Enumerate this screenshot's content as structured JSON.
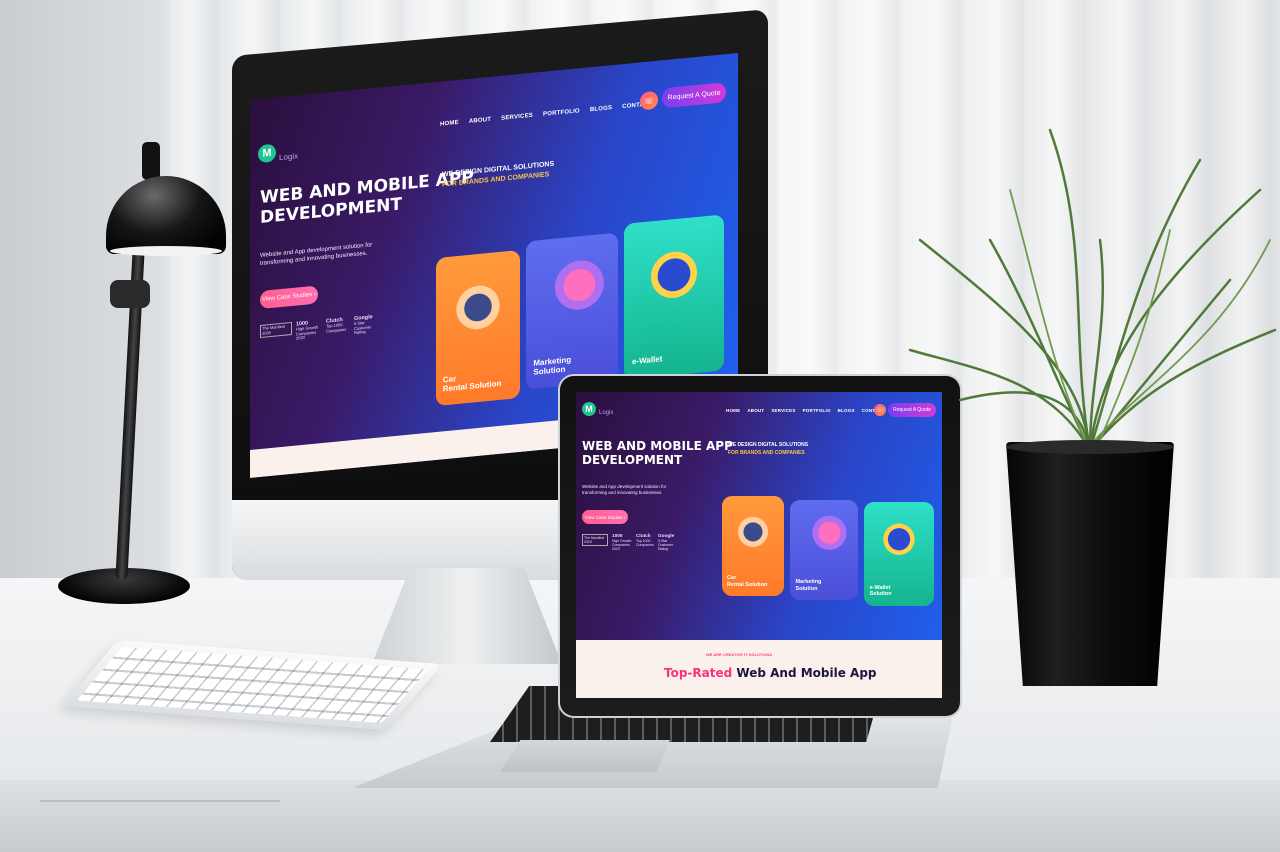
{
  "scene": {
    "description_free": true
  },
  "site": {
    "logo_letter": "M",
    "logo_text": "Logix",
    "nav": [
      "HOME",
      "ABOUT",
      "SERVICES",
      "PORTFOLIO",
      "BLOGS",
      "CONTACT"
    ],
    "quote_label": "Request A Quote",
    "hero_title_line1": "WEB AND MOBILE APP",
    "hero_title_line2": "DEVELOPMENT",
    "hero_desc_line1": "Website and App development solution for",
    "hero_desc_line2": "transforming and innovating businesses.",
    "case_button": "View Case Studies",
    "tagline_line1": "WE DESIGN DIGITAL SOLUTIONS",
    "tagline_line2": "FOR BRANDS AND COMPANIES",
    "awards": [
      {
        "top": "The Manifest",
        "bold": "",
        "sub": "2020"
      },
      {
        "top": "",
        "bold": "1000",
        "sub": "High Growth Companies 2020"
      },
      {
        "top": "",
        "bold": "Clutch",
        "sub": "Top 1000 Companies"
      },
      {
        "top": "",
        "bold": "Google",
        "sub": "5 Star Customer Rating"
      }
    ],
    "cards": [
      {
        "line1": "Car",
        "line2": "Rental Solution",
        "color_top": "#ff9a3c",
        "color_bottom": "#ff7a2a"
      },
      {
        "line1": "Marketing",
        "line2": "Solution",
        "color_top": "#5f6df0",
        "color_bottom": "#4a4fd8"
      },
      {
        "line1": "e-Wallet",
        "line2": "Solution",
        "color_top": "#2fe0c8",
        "color_bottom": "#14b48e"
      }
    ],
    "below_kicker": "WE ARE CREATIVE IT SOLUTIONS",
    "below_title_pink": "Top-Rated",
    "below_title_rest": " Web And Mobile App"
  },
  "colors": {
    "accent_pink": "#ff2f7a",
    "accent_green": "#1fc48f",
    "tag_yellow": "#f5c74a"
  }
}
